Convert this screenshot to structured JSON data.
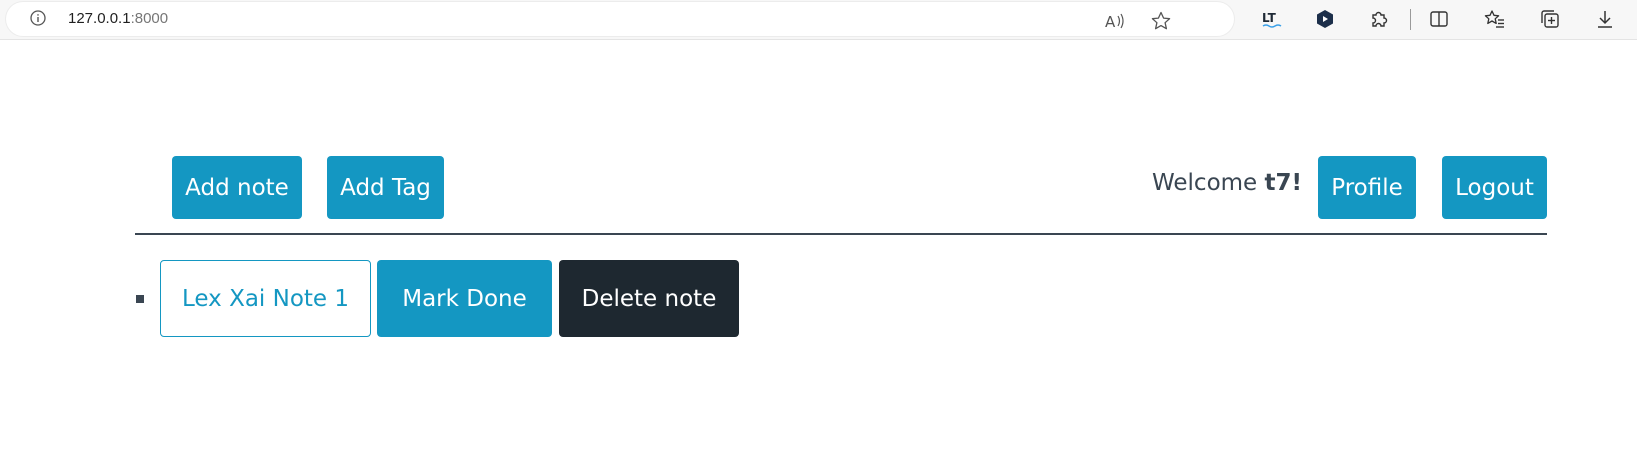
{
  "browser": {
    "url_host": "127.0.0.1",
    "url_port": ":8000",
    "icons": [
      "read-aloud-icon",
      "favorite-star-icon",
      "languagetool-icon",
      "extension-shield-icon",
      "extensions-puzzle-icon",
      "split-screen-icon",
      "favorites-icon",
      "collections-icon",
      "downloads-icon"
    ]
  },
  "nav": {
    "add_note_label": "Add note",
    "add_tag_label": "Add Tag",
    "welcome_prefix": "Welcome ",
    "username": "t7!",
    "profile_label": "Profile",
    "logout_label": "Logout"
  },
  "notes": [
    {
      "title": "Lex Xai Note 1",
      "mark_done_label": "Mark Done",
      "delete_label": "Delete note"
    }
  ],
  "colors": {
    "primary": "#1497c2",
    "dark": "#1e2830",
    "text": "#3a4652"
  }
}
